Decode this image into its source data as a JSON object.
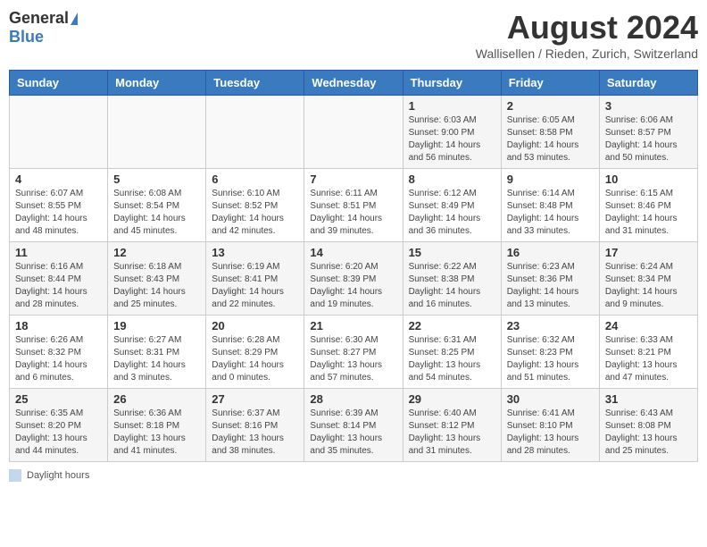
{
  "header": {
    "logo_general": "General",
    "logo_blue": "Blue",
    "month_title": "August 2024",
    "location": "Wallisellen / Rieden, Zurich, Switzerland"
  },
  "calendar": {
    "days_of_week": [
      "Sunday",
      "Monday",
      "Tuesday",
      "Wednesday",
      "Thursday",
      "Friday",
      "Saturday"
    ],
    "weeks": [
      [
        {
          "day": "",
          "info": ""
        },
        {
          "day": "",
          "info": ""
        },
        {
          "day": "",
          "info": ""
        },
        {
          "day": "",
          "info": ""
        },
        {
          "day": "1",
          "info": "Sunrise: 6:03 AM\nSunset: 9:00 PM\nDaylight: 14 hours and 56 minutes."
        },
        {
          "day": "2",
          "info": "Sunrise: 6:05 AM\nSunset: 8:58 PM\nDaylight: 14 hours and 53 minutes."
        },
        {
          "day": "3",
          "info": "Sunrise: 6:06 AM\nSunset: 8:57 PM\nDaylight: 14 hours and 50 minutes."
        }
      ],
      [
        {
          "day": "4",
          "info": "Sunrise: 6:07 AM\nSunset: 8:55 PM\nDaylight: 14 hours and 48 minutes."
        },
        {
          "day": "5",
          "info": "Sunrise: 6:08 AM\nSunset: 8:54 PM\nDaylight: 14 hours and 45 minutes."
        },
        {
          "day": "6",
          "info": "Sunrise: 6:10 AM\nSunset: 8:52 PM\nDaylight: 14 hours and 42 minutes."
        },
        {
          "day": "7",
          "info": "Sunrise: 6:11 AM\nSunset: 8:51 PM\nDaylight: 14 hours and 39 minutes."
        },
        {
          "day": "8",
          "info": "Sunrise: 6:12 AM\nSunset: 8:49 PM\nDaylight: 14 hours and 36 minutes."
        },
        {
          "day": "9",
          "info": "Sunrise: 6:14 AM\nSunset: 8:48 PM\nDaylight: 14 hours and 33 minutes."
        },
        {
          "day": "10",
          "info": "Sunrise: 6:15 AM\nSunset: 8:46 PM\nDaylight: 14 hours and 31 minutes."
        }
      ],
      [
        {
          "day": "11",
          "info": "Sunrise: 6:16 AM\nSunset: 8:44 PM\nDaylight: 14 hours and 28 minutes."
        },
        {
          "day": "12",
          "info": "Sunrise: 6:18 AM\nSunset: 8:43 PM\nDaylight: 14 hours and 25 minutes."
        },
        {
          "day": "13",
          "info": "Sunrise: 6:19 AM\nSunset: 8:41 PM\nDaylight: 14 hours and 22 minutes."
        },
        {
          "day": "14",
          "info": "Sunrise: 6:20 AM\nSunset: 8:39 PM\nDaylight: 14 hours and 19 minutes."
        },
        {
          "day": "15",
          "info": "Sunrise: 6:22 AM\nSunset: 8:38 PM\nDaylight: 14 hours and 16 minutes."
        },
        {
          "day": "16",
          "info": "Sunrise: 6:23 AM\nSunset: 8:36 PM\nDaylight: 14 hours and 13 minutes."
        },
        {
          "day": "17",
          "info": "Sunrise: 6:24 AM\nSunset: 8:34 PM\nDaylight: 14 hours and 9 minutes."
        }
      ],
      [
        {
          "day": "18",
          "info": "Sunrise: 6:26 AM\nSunset: 8:32 PM\nDaylight: 14 hours and 6 minutes."
        },
        {
          "day": "19",
          "info": "Sunrise: 6:27 AM\nSunset: 8:31 PM\nDaylight: 14 hours and 3 minutes."
        },
        {
          "day": "20",
          "info": "Sunrise: 6:28 AM\nSunset: 8:29 PM\nDaylight: 14 hours and 0 minutes."
        },
        {
          "day": "21",
          "info": "Sunrise: 6:30 AM\nSunset: 8:27 PM\nDaylight: 13 hours and 57 minutes."
        },
        {
          "day": "22",
          "info": "Sunrise: 6:31 AM\nSunset: 8:25 PM\nDaylight: 13 hours and 54 minutes."
        },
        {
          "day": "23",
          "info": "Sunrise: 6:32 AM\nSunset: 8:23 PM\nDaylight: 13 hours and 51 minutes."
        },
        {
          "day": "24",
          "info": "Sunrise: 6:33 AM\nSunset: 8:21 PM\nDaylight: 13 hours and 47 minutes."
        }
      ],
      [
        {
          "day": "25",
          "info": "Sunrise: 6:35 AM\nSunset: 8:20 PM\nDaylight: 13 hours and 44 minutes."
        },
        {
          "day": "26",
          "info": "Sunrise: 6:36 AM\nSunset: 8:18 PM\nDaylight: 13 hours and 41 minutes."
        },
        {
          "day": "27",
          "info": "Sunrise: 6:37 AM\nSunset: 8:16 PM\nDaylight: 13 hours and 38 minutes."
        },
        {
          "day": "28",
          "info": "Sunrise: 6:39 AM\nSunset: 8:14 PM\nDaylight: 13 hours and 35 minutes."
        },
        {
          "day": "29",
          "info": "Sunrise: 6:40 AM\nSunset: 8:12 PM\nDaylight: 13 hours and 31 minutes."
        },
        {
          "day": "30",
          "info": "Sunrise: 6:41 AM\nSunset: 8:10 PM\nDaylight: 13 hours and 28 minutes."
        },
        {
          "day": "31",
          "info": "Sunrise: 6:43 AM\nSunset: 8:08 PM\nDaylight: 13 hours and 25 minutes."
        }
      ]
    ]
  },
  "footer": {
    "label": "Daylight hours"
  }
}
